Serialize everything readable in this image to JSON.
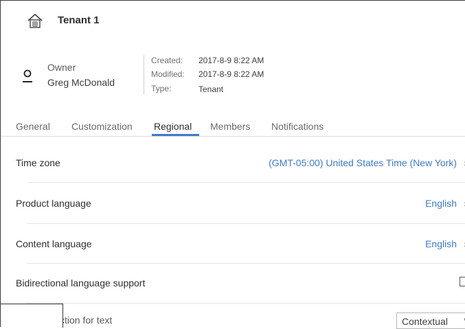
{
  "header": {
    "icon": "home-icon",
    "title": "Tenant 1"
  },
  "owner": {
    "icon": "user-icon",
    "label": "Owner",
    "name": "Greg McDonald"
  },
  "meta": {
    "created_label": "Created:",
    "created_value": "2017-8-9 8:22 AM",
    "modified_label": "Modified:",
    "modified_value": "2017-8-9 8:22 AM",
    "type_label": "Type:",
    "type_value": "Tenant"
  },
  "tabs": [
    {
      "label": "General"
    },
    {
      "label": "Customization"
    },
    {
      "label": "Regional",
      "active": true
    },
    {
      "label": "Members"
    },
    {
      "label": "Notifications"
    }
  ],
  "settings": {
    "time_zone": {
      "label": "Time zone",
      "value": "(GMT-05:00) United States Time (New York)"
    },
    "product_language": {
      "label": "Product language",
      "value": "English"
    },
    "content_language": {
      "label": "Content language",
      "value": "English"
    },
    "bidi": {
      "label": "Bidirectional language support",
      "checked": false
    },
    "text_direction": {
      "label": "ction for text",
      "value": "Contextual"
    }
  },
  "colors": {
    "accent": "#3d7cc9",
    "text": "#2e2e2e"
  }
}
